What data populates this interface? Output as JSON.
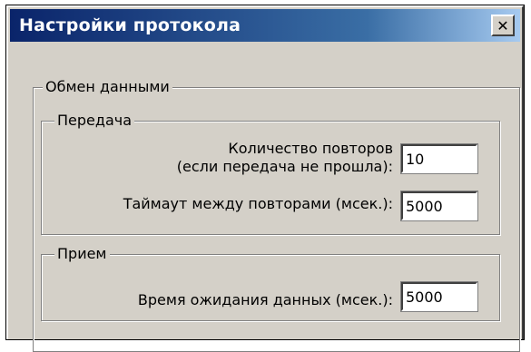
{
  "window": {
    "title": "Настройки протокола",
    "close_glyph": "✕",
    "close_icon": "close-icon"
  },
  "exchange": {
    "legend": "Обмен данными",
    "transmit": {
      "legend": "Передача",
      "retries_label_line1": "Количество повторов",
      "retries_label_line2": "(если передача не прошла):",
      "retries_value": "10",
      "timeout_label": "Таймаут между повторами (мсек.):",
      "timeout_value": "5000"
    },
    "receive": {
      "legend": "Прием",
      "wait_label": "Время ожидания данных (мсек.):",
      "wait_value": "5000"
    }
  }
}
